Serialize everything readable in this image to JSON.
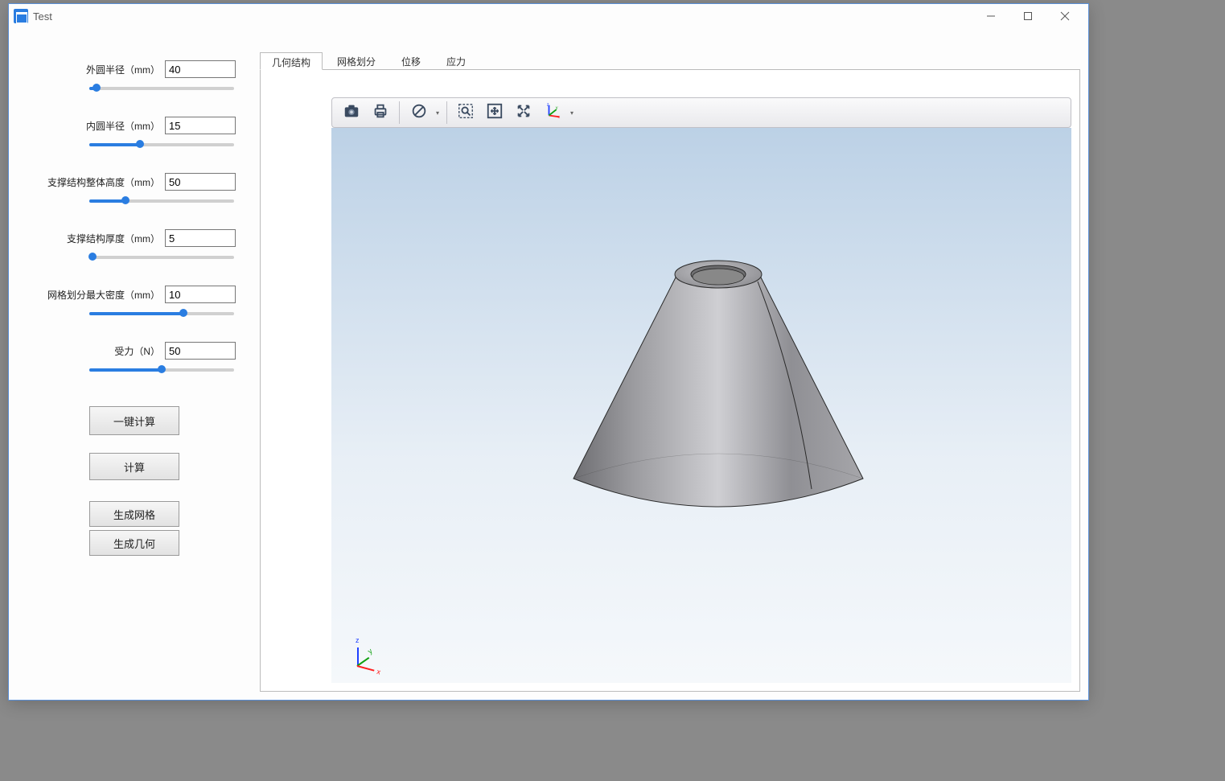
{
  "window": {
    "title": "Test"
  },
  "params": {
    "outer_radius": {
      "label": "外圆半径（mm）",
      "value": "40",
      "percent": 5
    },
    "inner_radius": {
      "label": "内圆半径（mm）",
      "value": "15",
      "percent": 35
    },
    "height": {
      "label": "支撑结构整体高度（mm）",
      "value": "50",
      "percent": 25
    },
    "thickness": {
      "label": "支撑结构厚度（mm）",
      "value": "5",
      "percent": 2
    },
    "mesh_density": {
      "label": "网格划分最大密度（mm）",
      "value": "10",
      "percent": 65
    },
    "force": {
      "label": "受力（N）",
      "value": "50",
      "percent": 50
    }
  },
  "buttons": {
    "one_click_calc": "一键计算",
    "calc": "计算",
    "gen_mesh": "生成网格",
    "gen_geom": "生成几何"
  },
  "tabs": {
    "geometry": "几何结构",
    "mesh": "网格划分",
    "displacement": "位移",
    "stress": "应力"
  },
  "toolbar": {
    "camera": "camera-icon",
    "print": "print-icon",
    "visibility": "visibility-icon",
    "zoom_box": "zoom-box-icon",
    "fit": "fit-view-icon",
    "rotate": "rotate-icon",
    "axes": "axes-icon"
  }
}
